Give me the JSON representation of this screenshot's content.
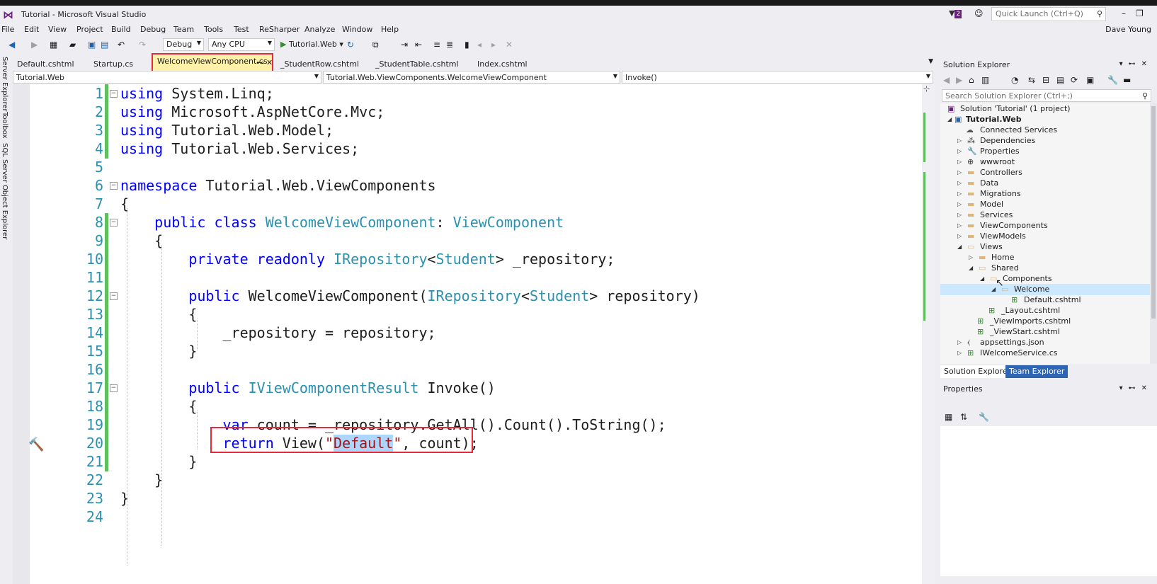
{
  "window": {
    "title": "Tutorial - Microsoft Visual Studio",
    "notification_count": "2",
    "quick_launch_placeholder": "Quick Launch (Ctrl+Q)",
    "user": "Dave Young"
  },
  "menu": [
    "File",
    "Edit",
    "View",
    "Project",
    "Build",
    "Debug",
    "Team",
    "Tools",
    "Test",
    "ReSharper",
    "Analyze",
    "Window",
    "Help"
  ],
  "toolbar": {
    "config": "Debug",
    "platform": "Any CPU",
    "run_target": "Tutorial.Web"
  },
  "left_strip": [
    "Server Explorer",
    "Toolbox",
    "SQL Server Object Explorer"
  ],
  "tabs": [
    {
      "label": "Default.cshtml"
    },
    {
      "label": "Startup.cs"
    },
    {
      "label": "WelcomeViewComponent.cs",
      "active": true
    },
    {
      "label": "_StudentRow.cshtml"
    },
    {
      "label": "_StudentTable.cshtml"
    },
    {
      "label": "Index.cshtml"
    }
  ],
  "navbar": {
    "project": "Tutorial.Web",
    "type": "Tutorial.Web.ViewComponents.WelcomeViewComponent",
    "member": "Invoke()"
  },
  "code": {
    "line_numbers": [
      "1",
      "2",
      "3",
      "4",
      "5",
      "6",
      "7",
      "8",
      "9",
      "10",
      "11",
      "12",
      "13",
      "14",
      "15",
      "16",
      "17",
      "18",
      "19",
      "20",
      "21",
      "22",
      "23",
      "24"
    ],
    "l1": {
      "kw": "using",
      "rest": " System.Linq;"
    },
    "l2": {
      "kw": "using",
      "rest": " Microsoft.AspNetCore.Mvc;"
    },
    "l3": {
      "kw": "using",
      "rest": " Tutorial.Web.Model;"
    },
    "l4": {
      "kw": "using",
      "rest": " Tutorial.Web.Services;"
    },
    "l6": {
      "kw": "namespace",
      "rest": " Tutorial.Web.ViewComponents"
    },
    "l7": "{",
    "l8": {
      "kw": "public class",
      "type1": "WelcomeViewComponent",
      "sep": ": ",
      "type2": "ViewComponent"
    },
    "l9": "{",
    "l10": {
      "kw": "private readonly",
      "type1": "IRepository",
      "lt": "<",
      "type2": "Student",
      "rest": "> _repository;"
    },
    "l12": {
      "kw": "public",
      "name": " WelcomeViewComponent(",
      "type1": "IRepository",
      "lt": "<",
      "type2": "Student",
      "rest": "> repository)"
    },
    "l13": "{",
    "l14": "_repository = repository;",
    "l15": "}",
    "l17": {
      "kw": "public",
      "type1": "IViewComponentResult",
      "rest": " Invoke()"
    },
    "l18": "{",
    "l19": {
      "kw": "var",
      "rest": " count = _repository.GetAll().Count().ToString();"
    },
    "l20": {
      "kw": "return",
      "pre": " View(",
      "q1": "\"",
      "sel": "Default",
      "q2": "\"",
      "rest": ", count);"
    },
    "l21": "}",
    "l22": "}",
    "l23": "}"
  },
  "solution_explorer": {
    "title": "Solution Explorer",
    "search_placeholder": "Search Solution Explorer (Ctrl+;)",
    "items": [
      {
        "label": "Solution 'Tutorial' (1 project)"
      },
      {
        "label": "Tutorial.Web"
      },
      {
        "label": "Connected Services"
      },
      {
        "label": "Dependencies"
      },
      {
        "label": "Properties"
      },
      {
        "label": "wwwroot"
      },
      {
        "label": "Controllers"
      },
      {
        "label": "Data"
      },
      {
        "label": "Migrations"
      },
      {
        "label": "Model"
      },
      {
        "label": "Services"
      },
      {
        "label": "ViewComponents"
      },
      {
        "label": "ViewModels"
      },
      {
        "label": "Views"
      },
      {
        "label": "Home"
      },
      {
        "label": "Shared"
      },
      {
        "label": "Components"
      },
      {
        "label": "Welcome"
      },
      {
        "label": "Default.cshtml"
      },
      {
        "label": "_Layout.cshtml"
      },
      {
        "label": "_ViewImports.cshtml"
      },
      {
        "label": "_ViewStart.cshtml"
      },
      {
        "label": "appsettings.json"
      },
      {
        "label": "IWelcomeService.cs"
      }
    ],
    "bottom_tabs": [
      "Solution Explorer",
      "Team Explorer"
    ]
  },
  "properties": {
    "title": "Properties"
  },
  "colors": {
    "accent_highlight": "#e8283c",
    "keyword": "#0000ff",
    "type": "#2b91af",
    "string": "#a31515",
    "line_number": "#2b91af"
  }
}
